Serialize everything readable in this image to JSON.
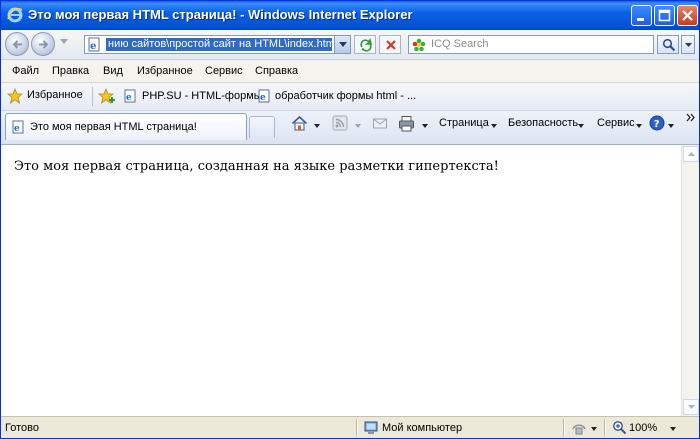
{
  "window": {
    "title": "Это моя первая HTML страница! - Windows Internet Explorer"
  },
  "address_bar": {
    "url": "нию сайтов\\простой сайт на HTML\\index.html"
  },
  "search": {
    "placeholder": "ICQ Search"
  },
  "menu": {
    "items": [
      "Файл",
      "Правка",
      "Вид",
      "Избранное",
      "Сервис",
      "Справка"
    ]
  },
  "favorites_bar": {
    "favorites_label": "Избранное",
    "links": [
      "PHP.SU - HTML-формы",
      "обработчик формы html - ..."
    ]
  },
  "tabs": [
    {
      "label": "Это моя первая HTML страница!"
    }
  ],
  "command_bar": {
    "page_label": "Страница",
    "safety_label": "Безопасность",
    "tools_label": "Сервис"
  },
  "content": {
    "text": "Это моя первая страница, созданная на языке разметки гипертекста!"
  },
  "status_bar": {
    "status": "Готово",
    "zone": "Мой компьютер",
    "zoom": "100%"
  },
  "icons": [
    "ie-logo-icon",
    "minimize-icon",
    "maximize-icon",
    "close-icon",
    "back-arrow-icon",
    "forward-arrow-icon",
    "page-icon",
    "refresh-icon",
    "stop-icon",
    "icq-flower-icon",
    "search-icon",
    "favorites-star-icon",
    "add-favorites-icon",
    "home-icon",
    "feeds-icon",
    "mail-icon",
    "print-icon",
    "help-icon",
    "computer-icon",
    "protected-mode-icon",
    "zoom-icon"
  ]
}
